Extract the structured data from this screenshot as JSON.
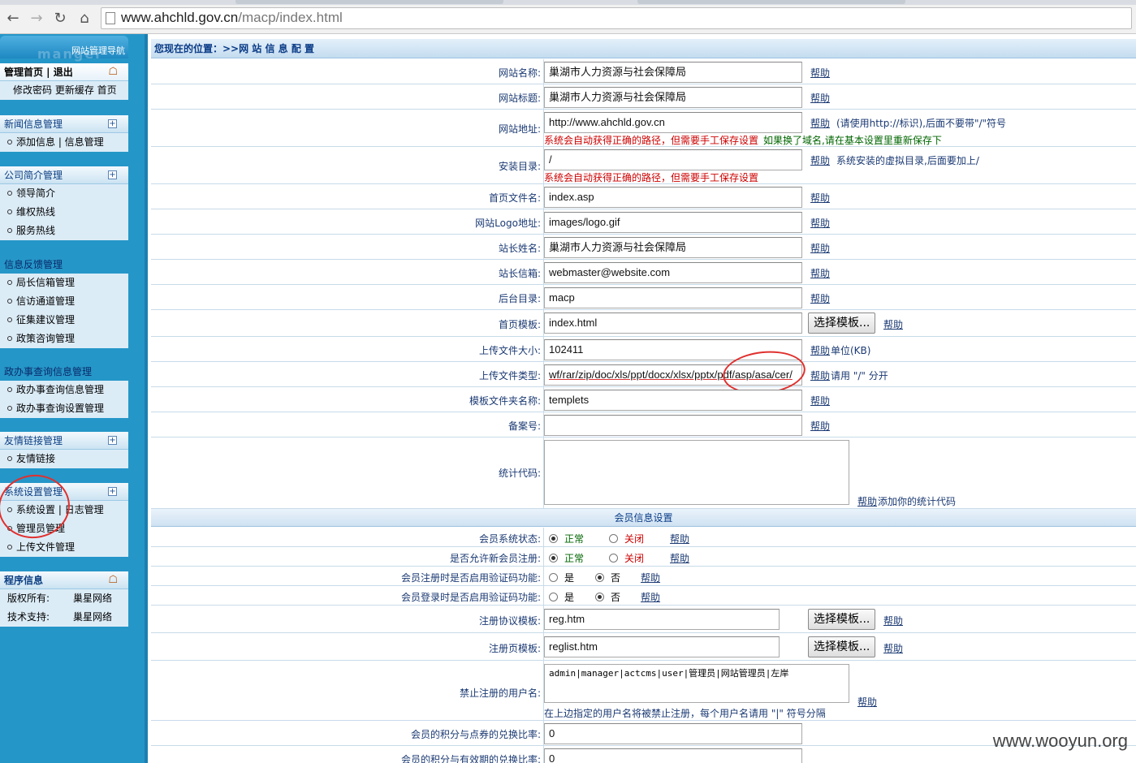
{
  "browser": {
    "url_host": "www.ahchld.gov.cn",
    "url_path": "/macp/index.html",
    "icons": [
      "back-icon",
      "forward-icon",
      "reload-icon",
      "home-icon",
      "page-icon"
    ]
  },
  "sidebar": {
    "brand_title": "网站管理导航",
    "brand_watermark": "manger",
    "top": {
      "head": "管理首页 | 退出",
      "links": "修改密码 更新缓存 首页"
    },
    "groups": [
      {
        "head": "新闻信息管理",
        "items": [
          "添加信息 | 信息管理"
        ]
      },
      {
        "head": "公司简介管理",
        "items": [
          "领导简介",
          "维权热线",
          "服务热线"
        ]
      },
      {
        "head": "信息反馈管理",
        "items": [
          "局长信箱管理",
          "信访通道管理",
          "征集建议管理",
          "政策咨询管理"
        ]
      },
      {
        "head": "政办事查询信息管理",
        "items": [
          "政办事查询信息管理",
          "政办事查询设置管理"
        ]
      },
      {
        "head": "友情链接管理",
        "items": [
          "友情链接"
        ]
      },
      {
        "head": "系统设置管理",
        "items": [
          "系统设置 | 日志管理",
          "管理员管理",
          "上传文件管理"
        ]
      }
    ],
    "info": {
      "head": "程序信息",
      "rows": [
        [
          "版权所有:",
          "巢星网络"
        ],
        [
          "技术支持:",
          "巢星网络"
        ]
      ]
    }
  },
  "main": {
    "position_label": "您现在的位置：>>网 站 信 息 配 置",
    "help": "帮助",
    "choose_template": "选择模板...",
    "fields": {
      "site_name": {
        "label": "网站名称:",
        "value": "巢湖市人力资源与社会保障局"
      },
      "site_title": {
        "label": "网站标题:",
        "value": "巢湖市人力资源与社会保障局"
      },
      "site_url": {
        "label": "网站地址:",
        "value": "http://www.ahchld.gov.cn",
        "note": "(请使用http://标识),后面不要带\"/\"符号",
        "auto_note": "系统会自动获得正确的路径，但需要手工保存设置",
        "green_note": "如果换了域名,请在基本设置里重新保存下"
      },
      "install_dir": {
        "label": "安装目录:",
        "value": "/",
        "note": "系统安装的虚拟目录,后面要加上/",
        "auto_note": "系统会自动获得正确的路径，但需要手工保存设置"
      },
      "index_file": {
        "label": "首页文件名:",
        "value": "index.asp"
      },
      "logo": {
        "label": "网站Logo地址:",
        "value": "images/logo.gif"
      },
      "master_name": {
        "label": "站长姓名:",
        "value": "巢湖市人力资源与社会保障局"
      },
      "master_email": {
        "label": "站长信箱:",
        "value": "webmaster@website.com"
      },
      "admin_dir": {
        "label": "后台目录:",
        "value": "macp"
      },
      "index_template": {
        "label": "首页模板:",
        "value": "index.html"
      },
      "upload_size": {
        "label": "上传文件大小:",
        "value": "102411",
        "note": "单位(KB)"
      },
      "upload_types": {
        "label": "上传文件类型:",
        "value": "wf/rar/zip/doc/xls/ppt/docx/xlsx/pptx/pdf/asp/asa/cer/",
        "note": "请用 \"/\" 分开"
      },
      "template_dir": {
        "label": "模板文件夹名称:",
        "value": "templets"
      },
      "icp": {
        "label": "备案号:",
        "value": ""
      },
      "stats_code": {
        "label": "统计代码:",
        "value": "",
        "note": "添加你的统计代码"
      }
    },
    "member_section": "会员信息设置",
    "member": {
      "status": {
        "label": "会员系统状态:",
        "on": "正常",
        "off": "关闭"
      },
      "allow_reg": {
        "label": "是否允许新会员注册:",
        "on": "正常",
        "off": "关闭"
      },
      "reg_captcha": {
        "label": "会员注册时是否启用验证码功能:",
        "yes": "是",
        "no": "否"
      },
      "login_captcha": {
        "label": "会员登录时是否启用验证码功能:",
        "yes": "是",
        "no": "否"
      },
      "reg_agreement": {
        "label": "注册协议模板:",
        "value": "reg.htm"
      },
      "reg_page": {
        "label": "注册页模板:",
        "value": "reglist.htm"
      },
      "banned_names": {
        "label": "禁止注册的用户名:",
        "value": "admin|manager|actcms|user|管理员|网站管理员|左岸",
        "note": "在上边指定的用户名将被禁止注册，每个用户名请用 \"|\" 符号分隔"
      },
      "points_coupon": {
        "label": "会员的积分与点券的兑换比率:",
        "value": "0"
      },
      "points_validity": {
        "label": "会员的积分与有效期的兑换比率:",
        "value": "0"
      }
    }
  },
  "watermark": "www.wooyun.org",
  "colors": {
    "sidebar": "#2596c8",
    "annotation": "#e0302e",
    "label": "#1b3a73"
  }
}
